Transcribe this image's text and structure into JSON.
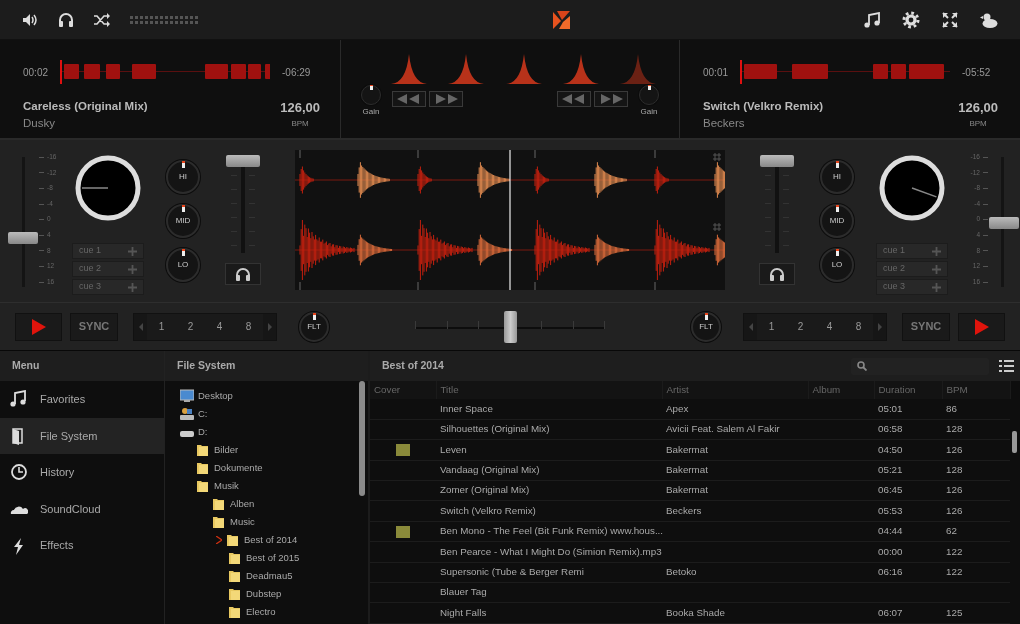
{
  "decks": [
    {
      "elapsed": "00:02",
      "remaining": "-06:29",
      "title": "Careless (Original Mix)",
      "artist": "Dusky",
      "bpm": "126,00",
      "bpm_unit": "BPM",
      "gain_label": "Gain",
      "pitch_scale": [
        "-16",
        "-12",
        "-8",
        "-4",
        "0",
        "4",
        "8",
        "12",
        "16"
      ],
      "pitch_fader": {
        "level": 0.38
      },
      "volume_fader": {
        "level": 1
      },
      "eq": [
        "HI",
        "MID",
        "LO"
      ],
      "cues": [
        "cue 1",
        "cue 2",
        "cue 3"
      ],
      "sync": "SYNC",
      "loop_sizes": [
        "1",
        "2",
        "4",
        "8"
      ],
      "filter": "FLT"
    },
    {
      "elapsed": "00:01",
      "remaining": "-05:52",
      "title": "Switch (Velkro Remix)",
      "artist": "Beckers",
      "bpm": "126,00",
      "bpm_unit": "BPM",
      "gain_label": "Gain",
      "pitch_scale": [
        "-16",
        "-12",
        "-8",
        "-4",
        "0",
        "4",
        "8",
        "12",
        "16"
      ],
      "pitch_fader": {
        "level": 0.5
      },
      "volume_fader": {
        "level": 1
      },
      "eq": [
        "HI",
        "MID",
        "LO"
      ],
      "cues": [
        "cue 1",
        "cue 2",
        "cue 3"
      ],
      "sync": "SYNC",
      "loop_sizes": [
        "1",
        "2",
        "4",
        "8"
      ],
      "filter": "FLT"
    }
  ],
  "crossfader": {
    "level": 0.5
  },
  "menu": {
    "title": "Menu",
    "items": [
      {
        "label": "Favorites",
        "kind": "note",
        "selected": false
      },
      {
        "label": "File System",
        "kind": "door",
        "selected": true
      },
      {
        "label": "History",
        "kind": "clock",
        "selected": false
      },
      {
        "label": "SoundCloud",
        "kind": "cloud",
        "selected": false
      },
      {
        "label": "Effects",
        "kind": "bolt",
        "selected": false
      }
    ]
  },
  "file_system": {
    "title": "File System",
    "tree": [
      {
        "label": "Desktop",
        "kind": "desktop",
        "selected": false
      },
      {
        "label": "C:",
        "kind": "system-drive",
        "selected": false
      },
      {
        "label": "D:",
        "kind": "drive",
        "selected": false,
        "children": [
          {
            "label": "Bilder",
            "kind": "folder",
            "selected": false
          },
          {
            "label": "Dokumente",
            "kind": "folder",
            "selected": false
          },
          {
            "label": "Musik",
            "kind": "folder",
            "selected": false,
            "children": [
              {
                "label": "Alben",
                "kind": "folder",
                "selected": false
              },
              {
                "label": "Music",
                "kind": "folder",
                "selected": false,
                "children": [
                  {
                    "label": "Best of 2014",
                    "kind": "folder",
                    "selected": true
                  },
                  {
                    "label": "Best of 2015",
                    "kind": "folder",
                    "selected": false
                  },
                  {
                    "label": "Deadmau5",
                    "kind": "folder",
                    "selected": false
                  },
                  {
                    "label": "Dubstep",
                    "kind": "folder",
                    "selected": false
                  },
                  {
                    "label": "Electro",
                    "kind": "folder",
                    "selected": false
                  }
                ]
              }
            ]
          }
        ]
      }
    ]
  },
  "playlist": {
    "title": "Best of 2014",
    "columns": [
      "Cover",
      "Title",
      "Artist",
      "Album",
      "Duration",
      "BPM"
    ],
    "rows": [
      {
        "cover": false,
        "title": "Inner Space",
        "artist": "Apex",
        "duration": "05:01",
        "bpm": "86"
      },
      {
        "cover": false,
        "title": "Silhouettes (Original Mix)",
        "artist": "Avicii Feat. Salem Al Fakir",
        "duration": "06:58",
        "bpm": "128"
      },
      {
        "cover": true,
        "title": "Leven",
        "artist": "Bakermat",
        "duration": "04:50",
        "bpm": "126"
      },
      {
        "cover": false,
        "title": "Vandaag (Original Mix)",
        "artist": "Bakermat",
        "duration": "05:21",
        "bpm": "128"
      },
      {
        "cover": false,
        "title": "Zomer (Original Mix)",
        "artist": "Bakermat",
        "duration": "06:45",
        "bpm": "126"
      },
      {
        "cover": false,
        "title": "Switch (Velkro Remix)",
        "artist": "Beckers",
        "duration": "05:53",
        "bpm": "126"
      },
      {
        "cover": true,
        "title": "Ben Mono - The Feel (Bit Funk Remix) www.hous...",
        "duration": "04:44",
        "bpm": "62"
      },
      {
        "cover": false,
        "title": "Ben Pearce - What I Might Do (Simion Remix).mp3",
        "duration": "00:00",
        "bpm": "122"
      },
      {
        "cover": false,
        "title": "Supersonic (Tube & Berger Remi",
        "artist": "Betoko",
        "duration": "06:16",
        "bpm": "122"
      },
      {
        "cover": false,
        "title": "Blauer Tag"
      },
      {
        "cover": false,
        "title": "Night Falls",
        "artist": "Booka Shade",
        "duration": "06:07",
        "bpm": "125"
      }
    ]
  }
}
